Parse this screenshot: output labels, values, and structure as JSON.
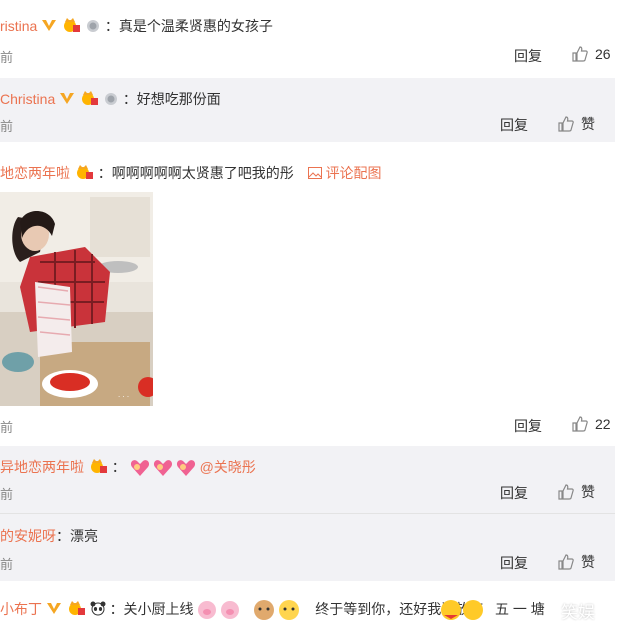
{
  "comments": [
    {
      "name": "ristina",
      "text": "：真是个温柔贤惠的女孩子",
      "time": "前",
      "reply": "回复",
      "likes": "26"
    },
    {
      "name": "Christina",
      "text": "：好想吃那份面",
      "time": "前",
      "reply": "回复",
      "likes": "赞"
    },
    {
      "name": "地恋两年啦",
      "text": "：啊啊啊啊啊太贤惠了吧我的彤",
      "attach": "评论配图",
      "time": "前",
      "reply": "回复",
      "likes": "22"
    },
    {
      "name": "异地恋两年啦",
      "text": "：",
      "mention": "@关晓彤",
      "time": "前",
      "reply": "回复",
      "likes": "赞"
    },
    {
      "name": "的安妮呀",
      "text": "：漂亮",
      "time": "前",
      "reply": "回复",
      "likes": "赞"
    },
    {
      "name": "小布丁",
      "text": "：关小厨上线",
      "text2": "终于等到你，还好我没放弃",
      "tail": "五 一 塘"
    }
  ],
  "watermark": "笑娱",
  "colors": {
    "accent": "#eb7350",
    "gray_bg": "#f2f2f5"
  }
}
